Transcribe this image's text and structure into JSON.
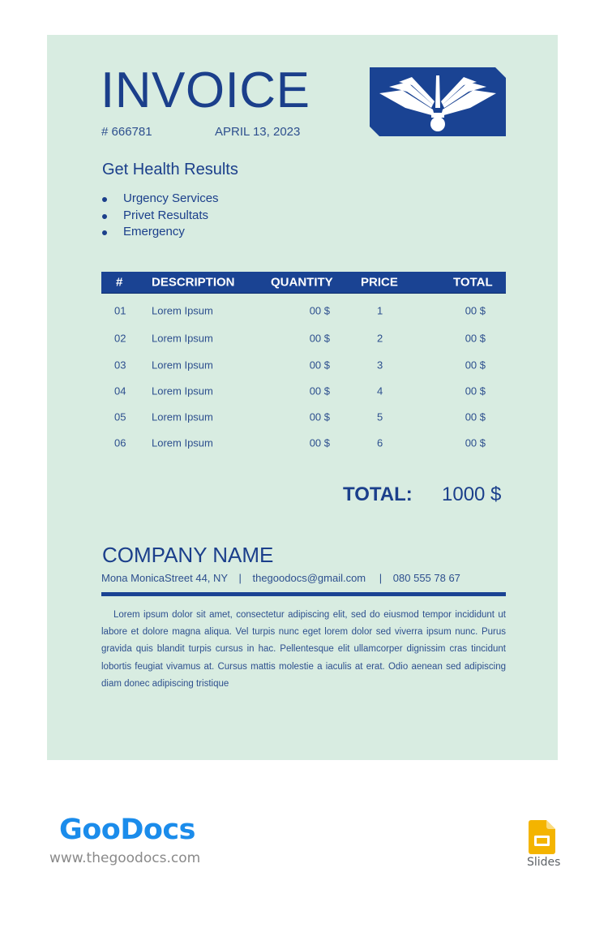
{
  "invoice": {
    "title": "INVOICE",
    "number": "# 666781",
    "date": "APRIL 13, 2023",
    "logo_icon": "winged-emblem-icon"
  },
  "services": {
    "heading": "Get Health Results",
    "items": [
      {
        "label": "Urgency Services"
      },
      {
        "label": "Privet Resultats"
      },
      {
        "label": "Emergency"
      }
    ]
  },
  "table": {
    "headers": {
      "num": "#",
      "description": "DESCRIPTION",
      "quantity": "QUANTITY",
      "price": "PRICE",
      "total": "TOTAL"
    },
    "rows": [
      {
        "num": "01",
        "description": "Lorem Ipsum",
        "quantity": "00 $",
        "price": "1",
        "total": "00 $"
      },
      {
        "num": "02",
        "description": "Lorem Ipsum",
        "quantity": "00 $",
        "price": "2",
        "total": "00 $"
      },
      {
        "num": "03",
        "description": "Lorem Ipsum",
        "quantity": "00 $",
        "price": "3",
        "total": "00 $"
      },
      {
        "num": "04",
        "description": "Lorem Ipsum",
        "quantity": "00 $",
        "price": "4",
        "total": "00 $"
      },
      {
        "num": "05",
        "description": "Lorem Ipsum",
        "quantity": "00 $",
        "price": "5",
        "total": "00 $"
      },
      {
        "num": "06",
        "description": "Lorem Ipsum",
        "quantity": "00 $",
        "price": "6",
        "total": "00 $"
      }
    ]
  },
  "summary": {
    "total_label": "TOTAL:",
    "total_value": "1000 $"
  },
  "company": {
    "name": "COMPANY NAME",
    "address": "Mona MonicaStreet 44, NY",
    "email": "thegoodocs@gmail.com",
    "phone": "080 555 78 67",
    "separator": "|",
    "paragraph": "Lorem ipsum dolor sit amet, consectetur adipiscing elit, sed do eiusmod tempor incididunt ut labore et dolore magna aliqua. Vel turpis nunc eget lorem dolor sed viverra ipsum nunc. Purus gravida quis blandit turpis cursus in hac. Pellentesque elit ullamcorper dignissim cras tincidunt lobortis feugiat vivamus at. Cursus mattis molestie a iaculis at erat. Odio aenean sed adipiscing diam donec adipiscing tristique"
  },
  "footer": {
    "brand": "GooDocs",
    "website": "www.thegoodocs.com",
    "app_label": "Slides",
    "app_icon": "google-slides-icon"
  },
  "colors": {
    "page_background": "#d8ece1",
    "primary_blue": "#1a4393",
    "text_blue": "#2d4f8e",
    "brand_blue": "#1b8ceb",
    "slides_yellow": "#f4b400"
  }
}
